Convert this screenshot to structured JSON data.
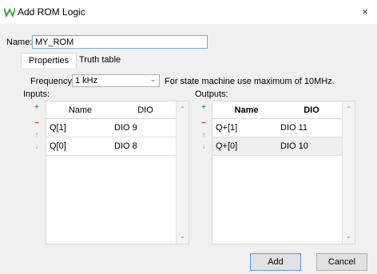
{
  "window": {
    "title": "Add ROM Logic",
    "close_glyph": "×",
    "app_icon": "w-logo-icon",
    "accent_color": "#3da53d"
  },
  "name": {
    "label": "Name:",
    "value": "MY_ROM"
  },
  "tabs": [
    {
      "label": "Properties",
      "active": true
    },
    {
      "label": "Truth table",
      "active": false
    }
  ],
  "properties": {
    "frequency_label": "Frequency:",
    "frequency_value": "1 kHz",
    "frequency_note": "For state machine use maximum of 10MHz.",
    "inputs_label": "Inputs:",
    "outputs_label": "Outputs:"
  },
  "inputs_table": {
    "columns": [
      "Name",
      "DIO"
    ],
    "rows": [
      {
        "name": "Q[1]",
        "dio": "DIO 9"
      },
      {
        "name": "Q[0]",
        "dio": "DIO 8"
      }
    ]
  },
  "outputs_table": {
    "columns": [
      "Name",
      "DIO"
    ],
    "rows": [
      {
        "name": "Q+[1]",
        "dio": "DIO 11"
      },
      {
        "name": "Q+[0]",
        "dio": "DIO 10"
      }
    ]
  },
  "side_buttons": {
    "add": "+",
    "remove": "−",
    "up": "↑",
    "down": "↓"
  },
  "buttons": {
    "add": "Add",
    "cancel": "Cancel"
  }
}
